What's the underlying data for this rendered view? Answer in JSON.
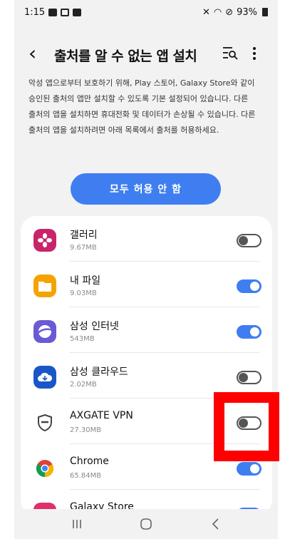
{
  "status_bar": {
    "time": "1:15",
    "battery": "93%"
  },
  "header": {
    "title": "출처를 알 수 없는 앱 설치"
  },
  "description": "악성 앱으로부터 보호하기 위해, Play 스토어, Galaxy Store와 같이 승인된 출처의 앱만 설치할 수 있도록 기본 설정되어 있습니다. 다른 출처의 앱을 설치하면 휴대전화 및 데이터가 손상될 수 있습니다. 다른 출처의 앱을 설치하려면 아래 목록에서 출처를 허용하세요.",
  "allow_all_button": "모두 허용 안 함",
  "apps": [
    {
      "name": "갤러리",
      "size": "9.67MB",
      "enabled": false,
      "icon": "gallery-icon"
    },
    {
      "name": "내 파일",
      "size": "9.03MB",
      "enabled": true,
      "icon": "my-files-icon"
    },
    {
      "name": "삼성 인터넷",
      "size": "543MB",
      "enabled": true,
      "icon": "samsung-internet-icon"
    },
    {
      "name": "삼성 클라우드",
      "size": "2.02MB",
      "enabled": false,
      "icon": "samsung-cloud-icon"
    },
    {
      "name": "AXGATE VPN",
      "size": "27.30MB",
      "enabled": false,
      "icon": "axgate-shield-icon"
    },
    {
      "name": "Chrome",
      "size": "65.84MB",
      "enabled": true,
      "icon": "chrome-icon"
    },
    {
      "name": "Galaxy Store",
      "size": "",
      "enabled": true,
      "icon": "galaxy-store-icon"
    }
  ],
  "colors": {
    "accent": "#3f7ef0",
    "highlight": "#ff0000"
  }
}
